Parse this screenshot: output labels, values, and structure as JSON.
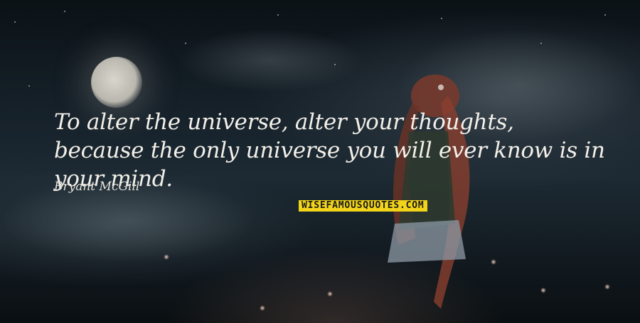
{
  "quote": {
    "text": "To alter the universe, alter your thoughts, because the only universe you will ever know is in your mind.",
    "author": "Bryant McGill"
  },
  "watermark": {
    "text": "WISEFAMOUSQUOTES.COM",
    "background_color": "#f2d51a"
  },
  "background": {
    "description_colors": [
      "#0b1216",
      "#1d2a33",
      "#0a0f12"
    ]
  }
}
